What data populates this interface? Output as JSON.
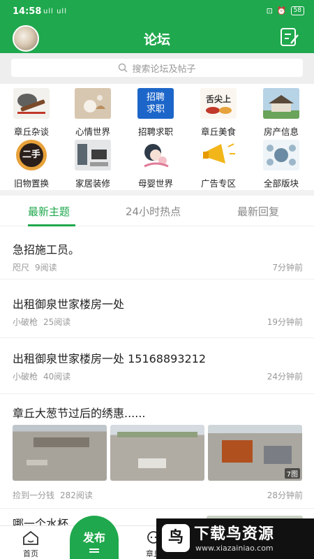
{
  "status_bar": {
    "time": "14:58",
    "signal": "ull ull",
    "battery": "58"
  },
  "header": {
    "title": "论坛"
  },
  "search": {
    "placeholder": "搜索论坛及帖子"
  },
  "categories": [
    {
      "label": "章丘杂谈",
      "icon": "guzheng-icon"
    },
    {
      "label": "心情世界",
      "icon": "mood-photo-icon"
    },
    {
      "label": "招聘求职",
      "icon": "recruit-icon",
      "img_text_1": "招聘",
      "img_text_2": "求职"
    },
    {
      "label": "章丘美食",
      "icon": "food-icon",
      "img_text": "舌尖上"
    },
    {
      "label": "房产信息",
      "icon": "house-icon"
    },
    {
      "label": "旧物置换",
      "icon": "secondhand-icon",
      "img_text": "二手"
    },
    {
      "label": "家居装修",
      "icon": "interior-icon"
    },
    {
      "label": "母婴世界",
      "icon": "baby-icon"
    },
    {
      "label": "广告专区",
      "icon": "megaphone-icon"
    },
    {
      "label": "全部版块",
      "icon": "all-sections-icon"
    }
  ],
  "tabs": [
    {
      "label": "最新主题",
      "active": true
    },
    {
      "label": "24小时热点",
      "active": false
    },
    {
      "label": "最新回复",
      "active": false
    }
  ],
  "posts": [
    {
      "title": "急招施工员。",
      "author": "咫尺",
      "reads": "9阅读",
      "time": "7分钟前"
    },
    {
      "title": "出租御泉世家楼房一处",
      "author": "小破枪",
      "reads": "25阅读",
      "time": "19分钟前"
    },
    {
      "title": "出租御泉世家楼房一处  15168893212",
      "author": "小破枪",
      "reads": "40阅读",
      "time": "24分钟前"
    },
    {
      "title": "章丘大葱节过后的绣惠......",
      "author": "捡到一分钱",
      "reads": "282阅读",
      "time": "28分钟前",
      "image_count": "7图"
    }
  ],
  "peek_post": {
    "title": "哪一个水杯"
  },
  "bottom_nav": {
    "home": "首页",
    "publish": "发布",
    "chat": "章丘"
  },
  "watermark": {
    "logo_char": "鸟",
    "title": "下载鸟资源",
    "url": "www.xiazainiao.com"
  },
  "colors": {
    "brand_green": "#1fa84d",
    "text": "#222222",
    "meta": "#999999"
  }
}
